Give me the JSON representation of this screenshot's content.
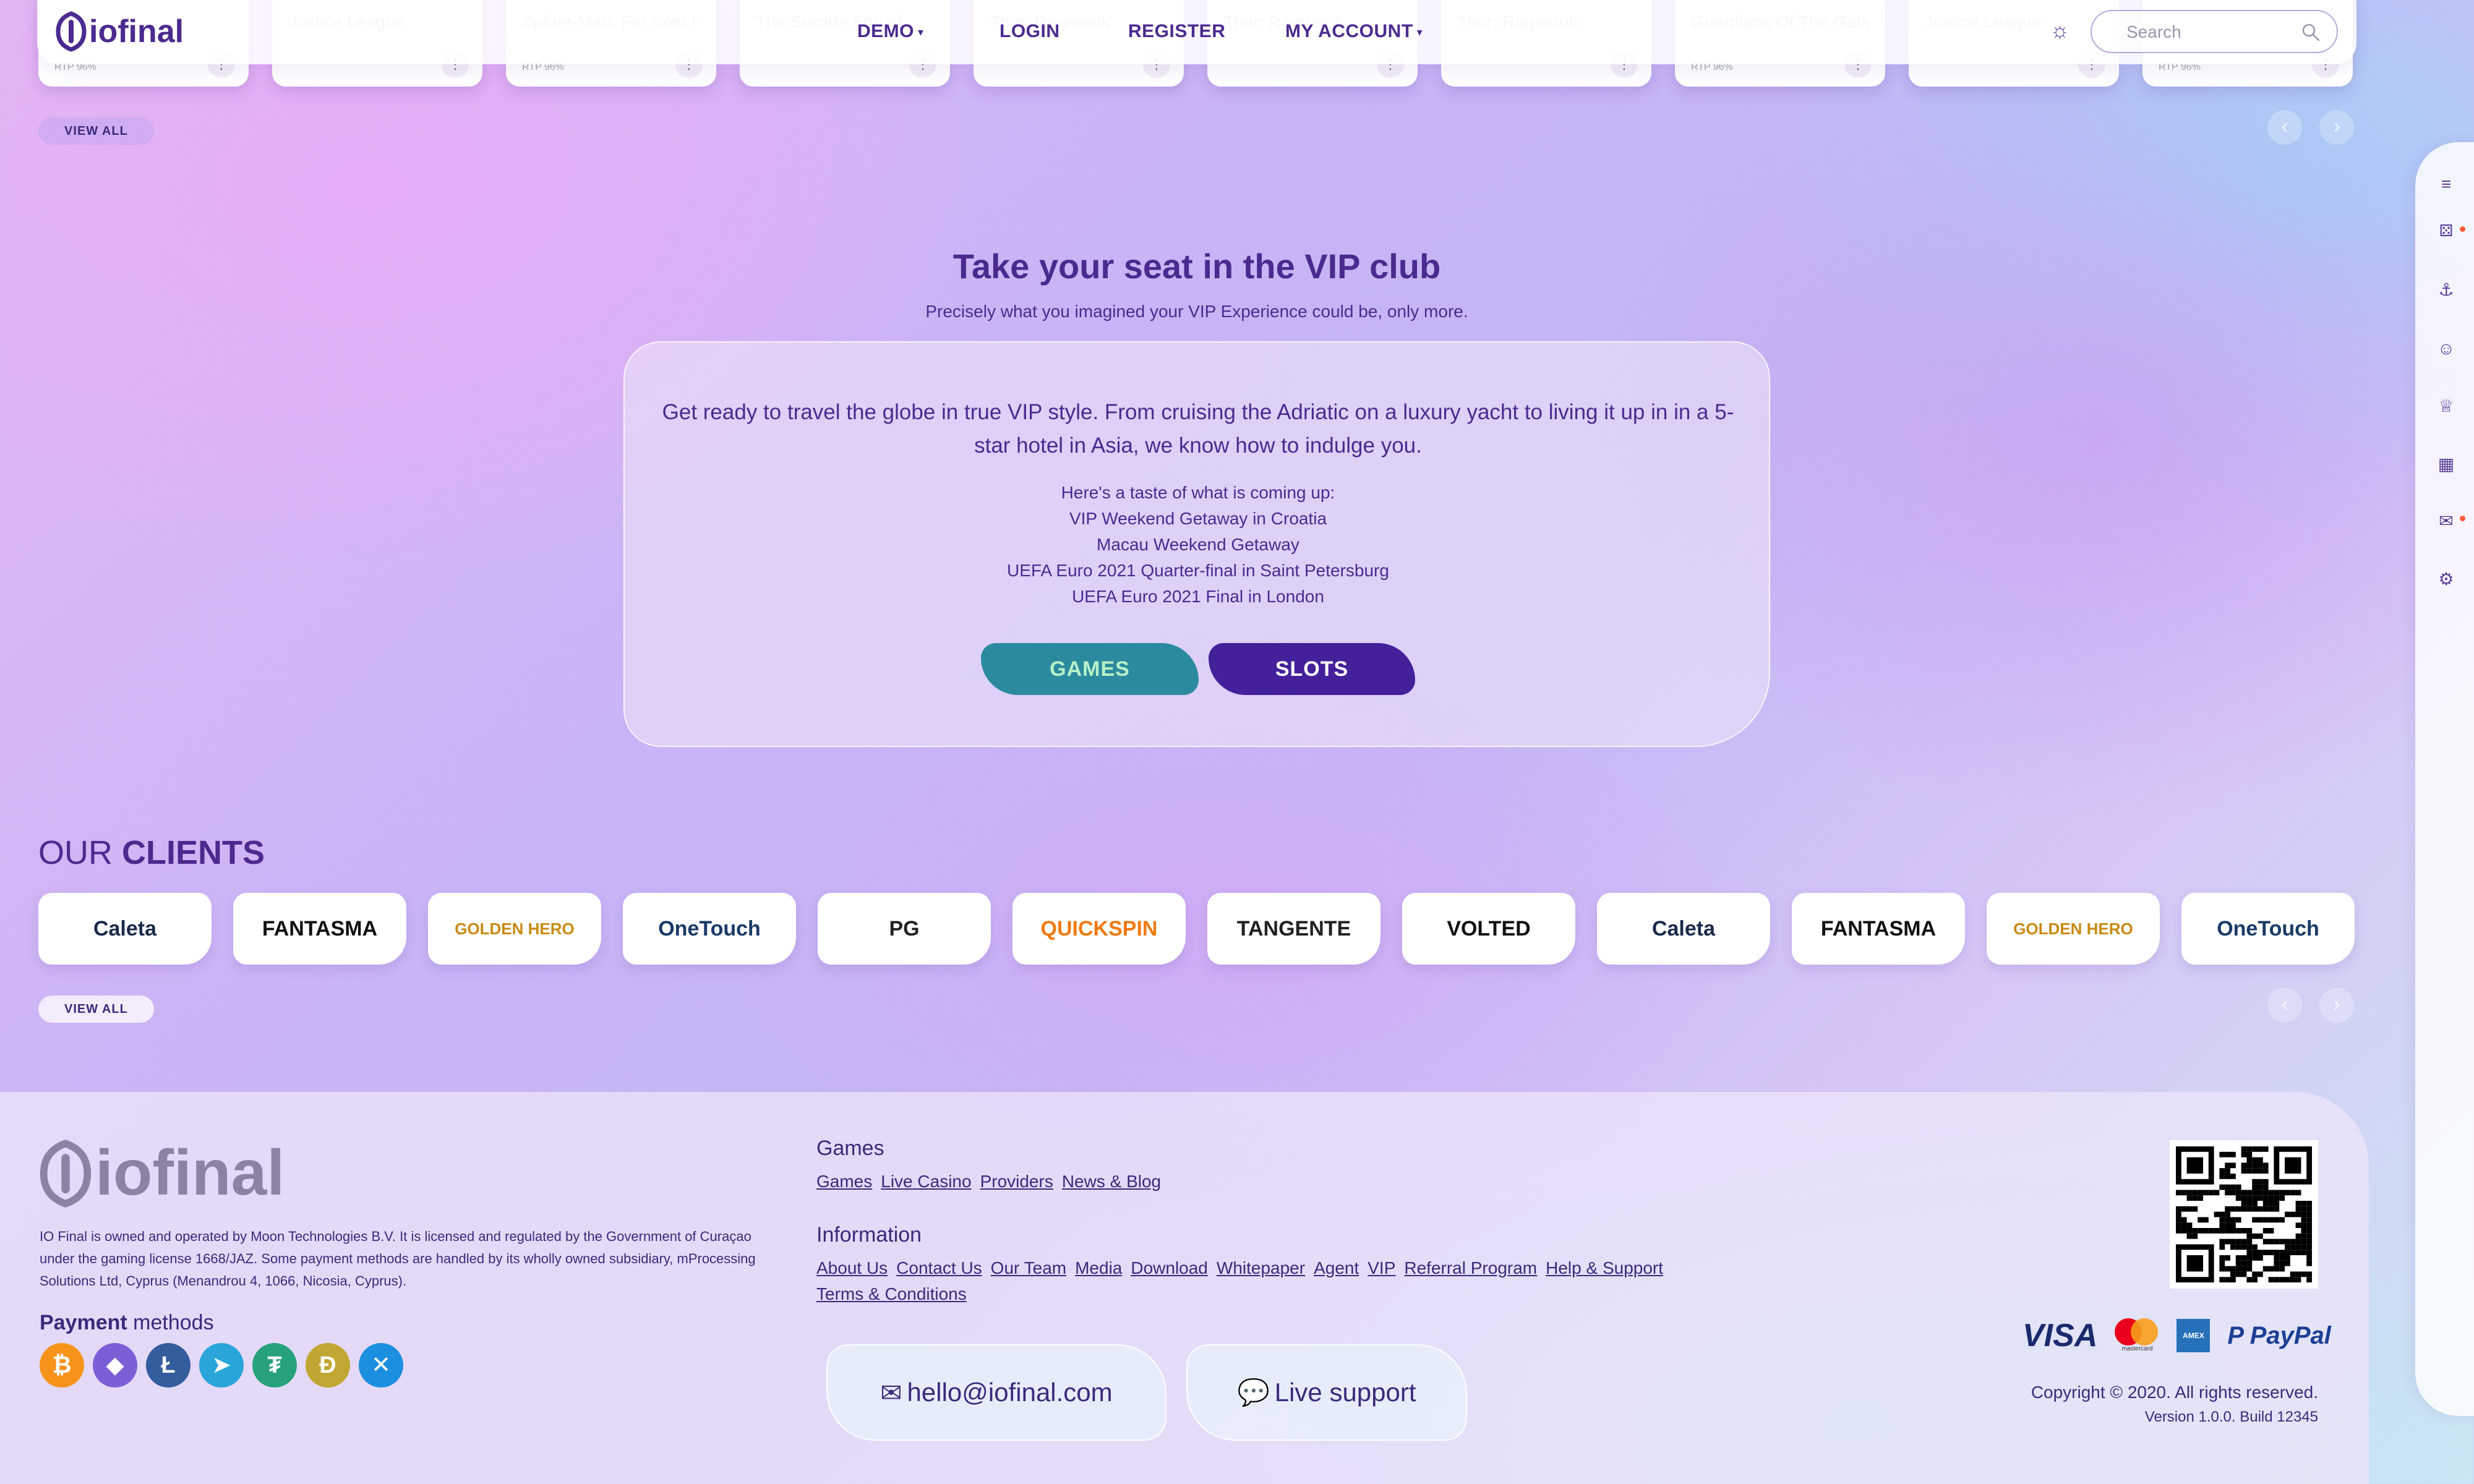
{
  "header": {
    "logo_text": "iofinal",
    "nav": {
      "demo": "DEMO",
      "login": "LOGIN",
      "register": "REGISTER",
      "my_account": "MY ACCOUNT"
    },
    "search_placeholder": "Search"
  },
  "games_strip": {
    "cards": [
      {
        "title": "",
        "sub": "",
        "tag": "RTP 96%"
      },
      {
        "title": "Justice League",
        "sub": "",
        "tag": ""
      },
      {
        "title": "Spider-Man: Far from Home",
        "sub": "",
        "tag": "RTP 96%"
      },
      {
        "title": "The Suicide Squad",
        "sub": "",
        "tag": ""
      },
      {
        "title": "Thor: Ragnarok",
        "sub": "",
        "tag": ""
      },
      {
        "title": "Thor: Ragnarok",
        "sub": "",
        "tag": ""
      },
      {
        "title": "Thor: Ragnarok",
        "sub": "",
        "tag": ""
      },
      {
        "title": "Guardians Of The Galaxy",
        "sub": "",
        "tag": "RTP 96%"
      },
      {
        "title": "Justice League",
        "sub": "",
        "tag": ""
      },
      {
        "title": "",
        "sub": "",
        "tag": "RTP 96%"
      }
    ],
    "view_all": "VIEW ALL"
  },
  "vip": {
    "title": "Take your seat in the VIP club",
    "subtitle": "Precisely what you imagined your VIP Experience could be, only more.",
    "intro": "Get ready to travel the globe in true VIP style. From cruising the Adriatic on a luxury yacht to living it up in in a 5-star hotel in Asia, we know how to indulge you.",
    "list_heading": "Here's a taste of what is coming up:",
    "list": [
      "VIP Weekend Getaway in Croatia",
      "Macau Weekend Getaway",
      "UEFA Euro 2021 Quarter-final in Saint Petersburg",
      "UEFA Euro 2021 Final in London"
    ],
    "games_button": "GAMES",
    "slots_button": "SLOTS"
  },
  "clients": {
    "title_light": "OUR ",
    "title_bold": "CLIENTS",
    "logos": [
      {
        "name": "Caleta",
        "color": "#1a2a4a"
      },
      {
        "name": "FANTASMA",
        "color": "#111111"
      },
      {
        "name": "GOLDEN HERO",
        "color": "#c98a12"
      },
      {
        "name": "OneTouch",
        "color": "#1a3a66"
      },
      {
        "name": "PG",
        "color": "#222222"
      },
      {
        "name": "QUICKSPIN",
        "color": "#f07a10"
      },
      {
        "name": "TANGENTE",
        "color": "#222222"
      },
      {
        "name": "VOLTED",
        "color": "#111111"
      },
      {
        "name": "Caleta",
        "color": "#1a2a4a"
      },
      {
        "name": "FANTASMA",
        "color": "#111111"
      },
      {
        "name": "GOLDEN HERO",
        "color": "#c98a12"
      },
      {
        "name": "OneTouch",
        "color": "#1a3a66"
      }
    ],
    "view_all": "VIEW ALL"
  },
  "footer": {
    "logo_text": "iofinal",
    "legal": "IO Final is owned and operated by Moon Technologies B.V. It is licensed and regulated by the Government of Curaçao under the gaming license 1668/JAZ. Some payment methods are handled by its wholly owned subsidiary, mProcessing Solutions Ltd, Cyprus (Menandrou 4, 1066, Nicosia, Cyprus).",
    "payment_bold": "Payment",
    "payment_light": " methods",
    "coins": [
      {
        "icon": "bitcoin-icon",
        "glyph": "₿",
        "color": "#f7931a"
      },
      {
        "icon": "ethereum-icon",
        "glyph": "◆",
        "color": "#7b5fd6"
      },
      {
        "icon": "litecoin-icon",
        "glyph": "Ł",
        "color": "#345d9d"
      },
      {
        "icon": "telegram-icon",
        "glyph": "➤",
        "color": "#2aa5d9"
      },
      {
        "icon": "tether-icon",
        "glyph": "₮",
        "color": "#26a17b"
      },
      {
        "icon": "dogecoin-icon",
        "glyph": "Đ",
        "color": "#c2a633"
      },
      {
        "icon": "ripple-icon",
        "glyph": "✕",
        "color": "#1d8fe0"
      }
    ],
    "games_heading": "Games",
    "games_links": [
      "Games",
      "Live Casino",
      "Providers",
      "News & Blog"
    ],
    "info_heading": "Information",
    "info_links": [
      "About Us",
      "Contact Us",
      "Our Team",
      "Media",
      "Download",
      "Whitepaper",
      "Agent",
      "VIP",
      "Referral Program",
      "Help & Support",
      "Terms & Conditions"
    ],
    "email": "hello@iofinal.com",
    "live_support": "Live support",
    "payment_brands": [
      "VISA",
      "mastercard",
      "AMEX",
      "PayPal"
    ],
    "copyright": "Copyright © 2020. All rights reserved.",
    "version": "Version 1.0.0. Build 12345"
  },
  "colors": {
    "brand": "#4b2a8f",
    "games_button": "#2b8a9e",
    "slots_button": "#44209a"
  }
}
